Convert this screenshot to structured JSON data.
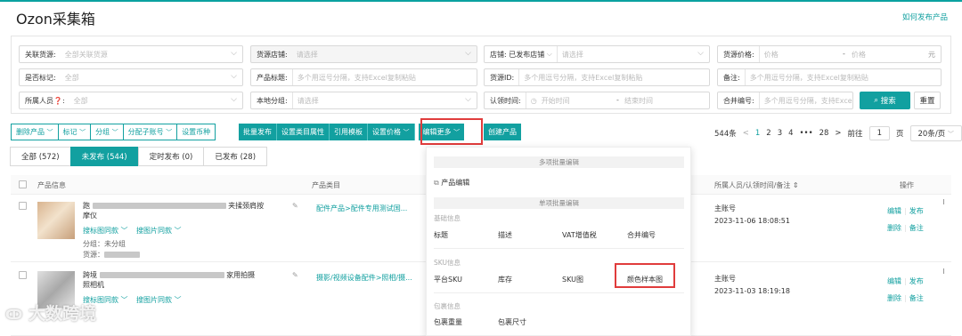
{
  "app": {
    "title": "Ozon采集箱",
    "help_link": "如何发布产品"
  },
  "filters": {
    "r1": [
      {
        "label": "关联货源:",
        "value": "全部关联货源"
      },
      {
        "label": "货源店铺:",
        "value": "请选择"
      },
      {
        "label": "店铺:",
        "value": "已发布店铺",
        "value2": "请选择"
      },
      {
        "label": "货源价格:",
        "min": "价格",
        "dash": "-",
        "max": "价格",
        "unit": "元"
      }
    ],
    "r2": [
      {
        "label": "是否标记:",
        "value": "全部"
      },
      {
        "label": "产品标题:",
        "value": "多个用逗号分隔，支持Excel复制粘贴"
      },
      {
        "label": "货源ID:",
        "value": "多个用逗号分隔，支持Excel复制粘贴"
      },
      {
        "label": "备注:",
        "value": "多个用逗号分隔，支持Excel复制粘贴"
      }
    ],
    "r3": [
      {
        "label": "所属人员❓:",
        "value": "全部"
      },
      {
        "label": "本地分组:",
        "value": "请选择"
      },
      {
        "label": "认领时间:",
        "start": "开始时间",
        "dash": "-",
        "end": "结束时间"
      },
      {
        "label": "合并编号:",
        "value": "多个用逗号分隔，支持Exce"
      }
    ],
    "search_label": "搜索",
    "reset_label": "重置"
  },
  "toolbar": {
    "outline": [
      {
        "label": "删除产品",
        "chev": "﹀"
      },
      {
        "label": "标记",
        "chev": "﹀"
      },
      {
        "label": "分组",
        "chev": "﹀"
      },
      {
        "label": "分配子账号",
        "chev": "﹀"
      },
      {
        "label": "设置币种",
        "chev": ""
      }
    ],
    "fill": [
      {
        "label": "批量发布"
      },
      {
        "label": "设置类目属性"
      },
      {
        "label": "引用模板"
      },
      {
        "label": "设置价格",
        "chev": "﹀"
      },
      {
        "label": "编辑更多",
        "chev": "﹀"
      }
    ],
    "create": "创建产品"
  },
  "pager": {
    "total": "544条",
    "prev": "<",
    "pages": [
      "1",
      "2",
      "3",
      "4",
      "•••",
      "28"
    ],
    "next": ">",
    "goto_label": "前往",
    "goto_value": "1",
    "page_unit": "页",
    "page_size": "20条/页"
  },
  "tabs": [
    {
      "label": "全部 (572)"
    },
    {
      "label": "未发布 (544)"
    },
    {
      "label": "定时发布 (0)"
    },
    {
      "label": "已发布 (28)"
    }
  ],
  "table": {
    "headers": {
      "info": "产品信息",
      "category": "产品类目",
      "owner": "所属人员/认领时间/备注 ⇕",
      "ops": "操作"
    },
    "rows": [
      {
        "title_a": "跑",
        "title_b": "夹揉颈肩按",
        "title_c": "摩仪",
        "category": "配件产品>配件专用测试国...",
        "search_img": "搜标图同款",
        "search_img2": "搜图片同款",
        "group": "分组：未分组",
        "source": "货源：",
        "owner": "主账号",
        "time": "2023-11-06 18:08:51",
        "op1": "编辑",
        "op2": "发布",
        "op3": "删除",
        "op4": "备注"
      },
      {
        "title_a": "跨境",
        "title_b": "家用拍摄",
        "title_c": "照相机",
        "category": "摄影/视频设备配件>照相/摄...",
        "search_img": "搜标图同款",
        "search_img2": "搜图片同款",
        "group": "",
        "source": "",
        "owner": "主账号",
        "time": "2023-11-03 18:19:18",
        "op1": "编辑",
        "op2": "发布",
        "op3": "删除",
        "op4": "备注"
      }
    ]
  },
  "dropdown": {
    "batch_header": "多项批量编辑",
    "product_edit": "产品编辑",
    "single_header": "单项批量编辑",
    "basic_group": "基础信息",
    "basic_items": [
      "标题",
      "描述",
      "VAT增值税",
      "合并编号"
    ],
    "sku_group": "SKU信息",
    "sku_items": [
      "平台SKU",
      "库存",
      "SKU图",
      "颜色样本图"
    ],
    "pack_group": "包裹信息",
    "pack_items": [
      "包裹重量",
      "包裹尺寸"
    ]
  },
  "watermark": "大数跨境"
}
